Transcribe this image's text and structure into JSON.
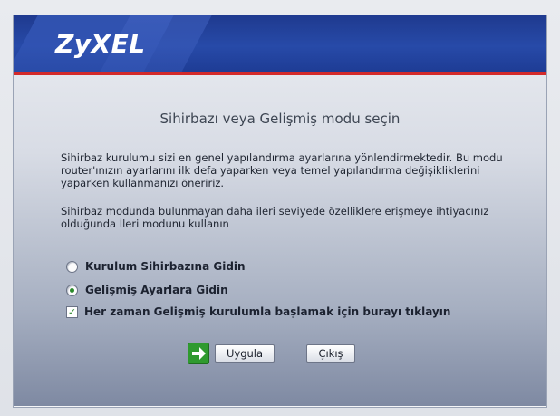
{
  "header": {
    "logo_text": "ZyXEL",
    "brand_color": "#1f3a8f",
    "accent_color": "#d32a2a"
  },
  "main": {
    "title": "Sihirbazı veya Gelişmiş modu seçin",
    "paragraph1": "Sihirbaz kurulumu sizi en genel yapılandırma ayarlarına yönlendirmektedir. Bu modu router'ınızın ayarlarını ilk defa yaparken veya temel yapılandırma değişikliklerini yaparken kullanmanızı öneririz.",
    "paragraph2": "Sihirbaz modunda bulunmayan daha ileri seviyede özelliklere erişmeye ihtiyacınız olduğunda İleri modunu kullanın",
    "options": [
      {
        "label": "Kurulum Sihirbazına Gidin",
        "selected": false
      },
      {
        "label": "Gelişmiş Ayarlara Gidin",
        "selected": true
      }
    ],
    "checkbox": {
      "label": "Her zaman Gelişmiş kurulumla başlamak için burayı tıklayın",
      "checked": true
    }
  },
  "buttons": {
    "apply_label": "Uygula",
    "exit_label": "Çıkış",
    "arrow_icon": "green-arrow-right-icon"
  }
}
